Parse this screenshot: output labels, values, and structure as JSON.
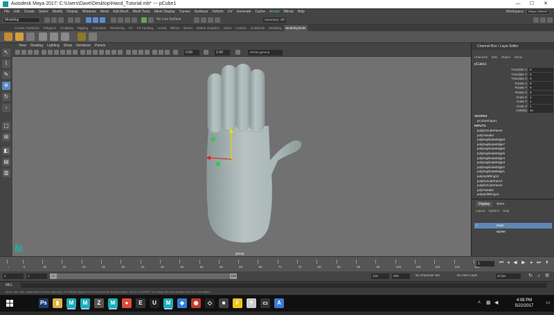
{
  "titlebar": {
    "title": "Autodesk Maya 2017: C:\\Users\\Dave\\Desktop\\Hand_Tutorial.mb* --- pCube1",
    "minimize": "—",
    "maximize": "☐",
    "close": "✕"
  },
  "menubar": {
    "items": [
      "File",
      "Edit",
      "Create",
      "Select",
      "Modify",
      "Display",
      "Windows",
      "Mesh",
      "Edit Mesh",
      "Mesh Tools",
      "Mesh Display",
      "Curves",
      "Surfaces",
      "Deform",
      "UV",
      "Generate",
      "Cache",
      "Arnold",
      "Bifrost",
      "Help"
    ],
    "active_index": 17,
    "workspace_label": "Workspace:",
    "workspace_value": "Maya Classic*"
  },
  "statusline": {
    "mode": "Modeling",
    "no_live_surface": "No Live Surface",
    "symmetry": "Symmetry: Off"
  },
  "shelf": {
    "tabs": [
      "Curves / Surfaces",
      "Polygons",
      "Sculpting",
      "Rigging",
      "Animation",
      "Rendering",
      "FX",
      "FX Caching",
      "Arnold",
      "Bifrost",
      "MASH",
      "Motion Graphics",
      "XGen",
      "Custom",
      "GoZBrush",
      "Modeling",
      "ModelingTools"
    ],
    "active_index": 16
  },
  "viewport": {
    "menu": [
      "View",
      "Shading",
      "Lighting",
      "Show",
      "Renderer",
      "Panels"
    ],
    "field_a": "0.00",
    "field_b": "1.00",
    "color_space": "sRGB gamma",
    "camera_label": "persp"
  },
  "channelbox": {
    "header": "Channel Box / Layer Editor",
    "menu": [
      "Channels",
      "Edit",
      "Object",
      "Show"
    ],
    "object": "pCube1",
    "attributes": [
      {
        "name": "Translate X",
        "value": "0"
      },
      {
        "name": "Translate Y",
        "value": "0"
      },
      {
        "name": "Translate Z",
        "value": "0"
      },
      {
        "name": "Rotate X",
        "value": "0"
      },
      {
        "name": "Rotate Y",
        "value": "0"
      },
      {
        "name": "Rotate Z",
        "value": "0"
      },
      {
        "name": "Scale X",
        "value": "1"
      },
      {
        "name": "Scale Y",
        "value": "1"
      },
      {
        "name": "Scale Z",
        "value": "1"
      },
      {
        "name": "Visibility",
        "value": "on"
      }
    ],
    "shapes_label": "SHAPES",
    "shape_name": "pCubeShape1",
    "inputs_label": "INPUTS",
    "inputs": [
      "polyExtrudeFace5",
      "polyTweak3",
      "polyDuplicateEdge8",
      "polyDuplicateEdge7",
      "polyDuplicateEdge6",
      "polyDuplicateEdge5",
      "polyDuplicateEdge4",
      "polyDuplicateEdge3",
      "polyDuplicateEdge2",
      "polyDuplicateEdge1",
      "polySplitRing15",
      "polyExtrudeFace4",
      "polyExtrudeFace3",
      "polyTweak2",
      "polySplitRing14"
    ]
  },
  "layereditor": {
    "tabs": [
      "Display",
      "Anim"
    ],
    "menu": [
      "Layers",
      "Options",
      "Help"
    ],
    "layers": [
      {
        "vis": "V",
        "name": "Dave",
        "selected": true
      },
      {
        "vis": "",
        "name": "Hjcher",
        "selected": false
      }
    ]
  },
  "timeslider": {
    "ticks": [
      "1",
      "5",
      "10",
      "15",
      "20",
      "25",
      "30",
      "35",
      "40",
      "45",
      "50",
      "55",
      "60",
      "65",
      "70",
      "75",
      "80",
      "85",
      "90",
      "95",
      "100",
      "105",
      "110",
      "115",
      "120"
    ],
    "current_frame": "1"
  },
  "rangeslider": {
    "start": "1",
    "playback_start": "1",
    "range_left": "1",
    "range_right": "120",
    "playback_end": "120",
    "end": "200",
    "character_set": "No Character Set",
    "anim_layer": "No Anim Layer",
    "fps": "24 fps"
  },
  "mel": {
    "label": "MEL"
  },
  "helpline": {
    "text": "Move Tool: Use manipulator to move object(s). Ctrl+MMB+drag to move components along normals. Use D or INSERT to change the pivot position and axis orientation."
  },
  "taskbar": {
    "time": "4:08 PM",
    "date": "5/22/2017",
    "icons": [
      {
        "name": "photoshop",
        "color": "#1c3d6e",
        "glyph": "Ps"
      },
      {
        "name": "file-explorer",
        "color": "#e0b040",
        "glyph": "▮"
      },
      {
        "name": "maya-a",
        "color": "#1bb0b6",
        "glyph": "M"
      },
      {
        "name": "maya-b",
        "color": "#1bb0b6",
        "glyph": "M"
      },
      {
        "name": "zbrush",
        "color": "#555555",
        "glyph": "Z"
      },
      {
        "name": "maya-c",
        "color": "#1bb0b6",
        "glyph": "M"
      },
      {
        "name": "chrome",
        "color": "#dd4b39",
        "glyph": "●"
      },
      {
        "name": "epic",
        "color": "#333333",
        "glyph": "E"
      },
      {
        "name": "unreal",
        "color": "#222222",
        "glyph": "U"
      },
      {
        "name": "maya-d",
        "color": "#1bb0b6",
        "glyph": "M"
      },
      {
        "name": "dropbox",
        "color": "#2f7fd8",
        "glyph": "◆"
      },
      {
        "name": "app-red",
        "color": "#c0392b",
        "glyph": "◉"
      },
      {
        "name": "unity-a",
        "color": "#222222",
        "glyph": "◇"
      },
      {
        "name": "app-grey",
        "color": "#444444",
        "glyph": "■"
      },
      {
        "name": "app-f",
        "color": "#f0c419",
        "glyph": "F"
      },
      {
        "name": "app-figure",
        "color": "#cccccc",
        "glyph": "☥"
      },
      {
        "name": "app-box",
        "color": "#333333",
        "glyph": "▭"
      },
      {
        "name": "app-a",
        "color": "#3a7bd5",
        "glyph": "A"
      }
    ]
  }
}
